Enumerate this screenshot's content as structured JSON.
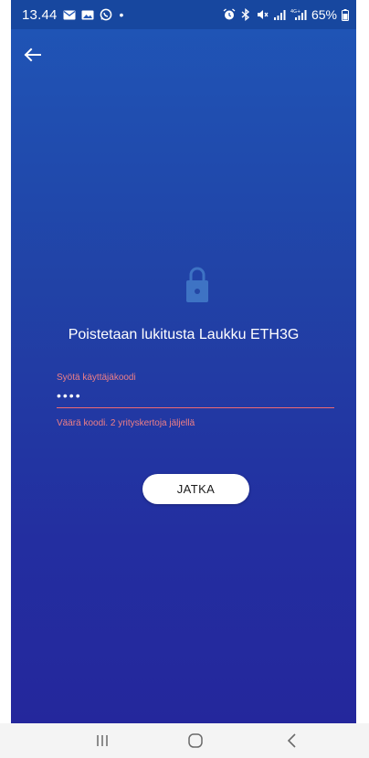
{
  "status_bar": {
    "time": "13.44",
    "dot": "•",
    "battery": "65%"
  },
  "header": {
    "back_icon": "arrow-left-icon"
  },
  "main": {
    "lock_icon": "lock-icon",
    "title": "Poistetaan lukitusta Laukku ETH3G",
    "code_field": {
      "label": "Syötä käyttäjäkoodi",
      "value": "••••",
      "error": "Väärä koodi. 2 yrityskertoja jäljellä"
    },
    "continue_button": "JATKA"
  },
  "navbar": {
    "recents_icon": "recents-icon",
    "home_icon": "home-icon",
    "back_icon": "back-chevron-icon"
  },
  "colors": {
    "gradient_top": "#1f56b7",
    "gradient_bottom": "#24279c",
    "error": "#ee7f86",
    "button_bg": "#ffffff"
  }
}
